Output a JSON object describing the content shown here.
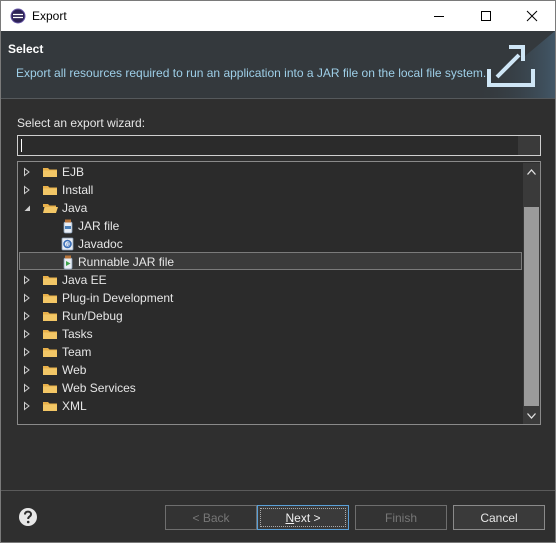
{
  "window": {
    "title": "Export",
    "controls": [
      "minimize",
      "maximize",
      "close"
    ]
  },
  "banner": {
    "title": "Select",
    "description": "Export all resources required to run an application into a JAR file on the local file system."
  },
  "wizard": {
    "prompt": "Select an export wizard:",
    "filter": {
      "value": "",
      "placeholder": ""
    },
    "tree": [
      {
        "label": "EJB",
        "type": "folder",
        "expanded": false,
        "level": 0
      },
      {
        "label": "Install",
        "type": "folder",
        "expanded": false,
        "level": 0
      },
      {
        "label": "Java",
        "type": "folder",
        "expanded": true,
        "level": 0
      },
      {
        "label": "JAR file",
        "type": "jar-icon",
        "level": 1
      },
      {
        "label": "Javadoc",
        "type": "javadoc-icon",
        "level": 1
      },
      {
        "label": "Runnable JAR file",
        "type": "runnable-jar-icon",
        "level": 1,
        "selected": true
      },
      {
        "label": "Java EE",
        "type": "folder",
        "expanded": false,
        "level": 0
      },
      {
        "label": "Plug-in Development",
        "type": "folder",
        "expanded": false,
        "level": 0
      },
      {
        "label": "Run/Debug",
        "type": "folder",
        "expanded": false,
        "level": 0
      },
      {
        "label": "Tasks",
        "type": "folder",
        "expanded": false,
        "level": 0
      },
      {
        "label": "Team",
        "type": "folder",
        "expanded": false,
        "level": 0
      },
      {
        "label": "Web",
        "type": "folder",
        "expanded": false,
        "level": 0
      },
      {
        "label": "Web Services",
        "type": "folder",
        "expanded": false,
        "level": 0
      },
      {
        "label": "XML",
        "type": "folder",
        "expanded": false,
        "level": 0
      }
    ]
  },
  "buttons": {
    "back": "< Back",
    "next_prefix": "",
    "next_mnemonic": "N",
    "next_rest": "ext >",
    "finish": "Finish",
    "cancel": "Cancel"
  },
  "colors": {
    "accent": "#5aa0d8",
    "banner_text": "#9ecfe8",
    "folder": "#e8b04a"
  }
}
